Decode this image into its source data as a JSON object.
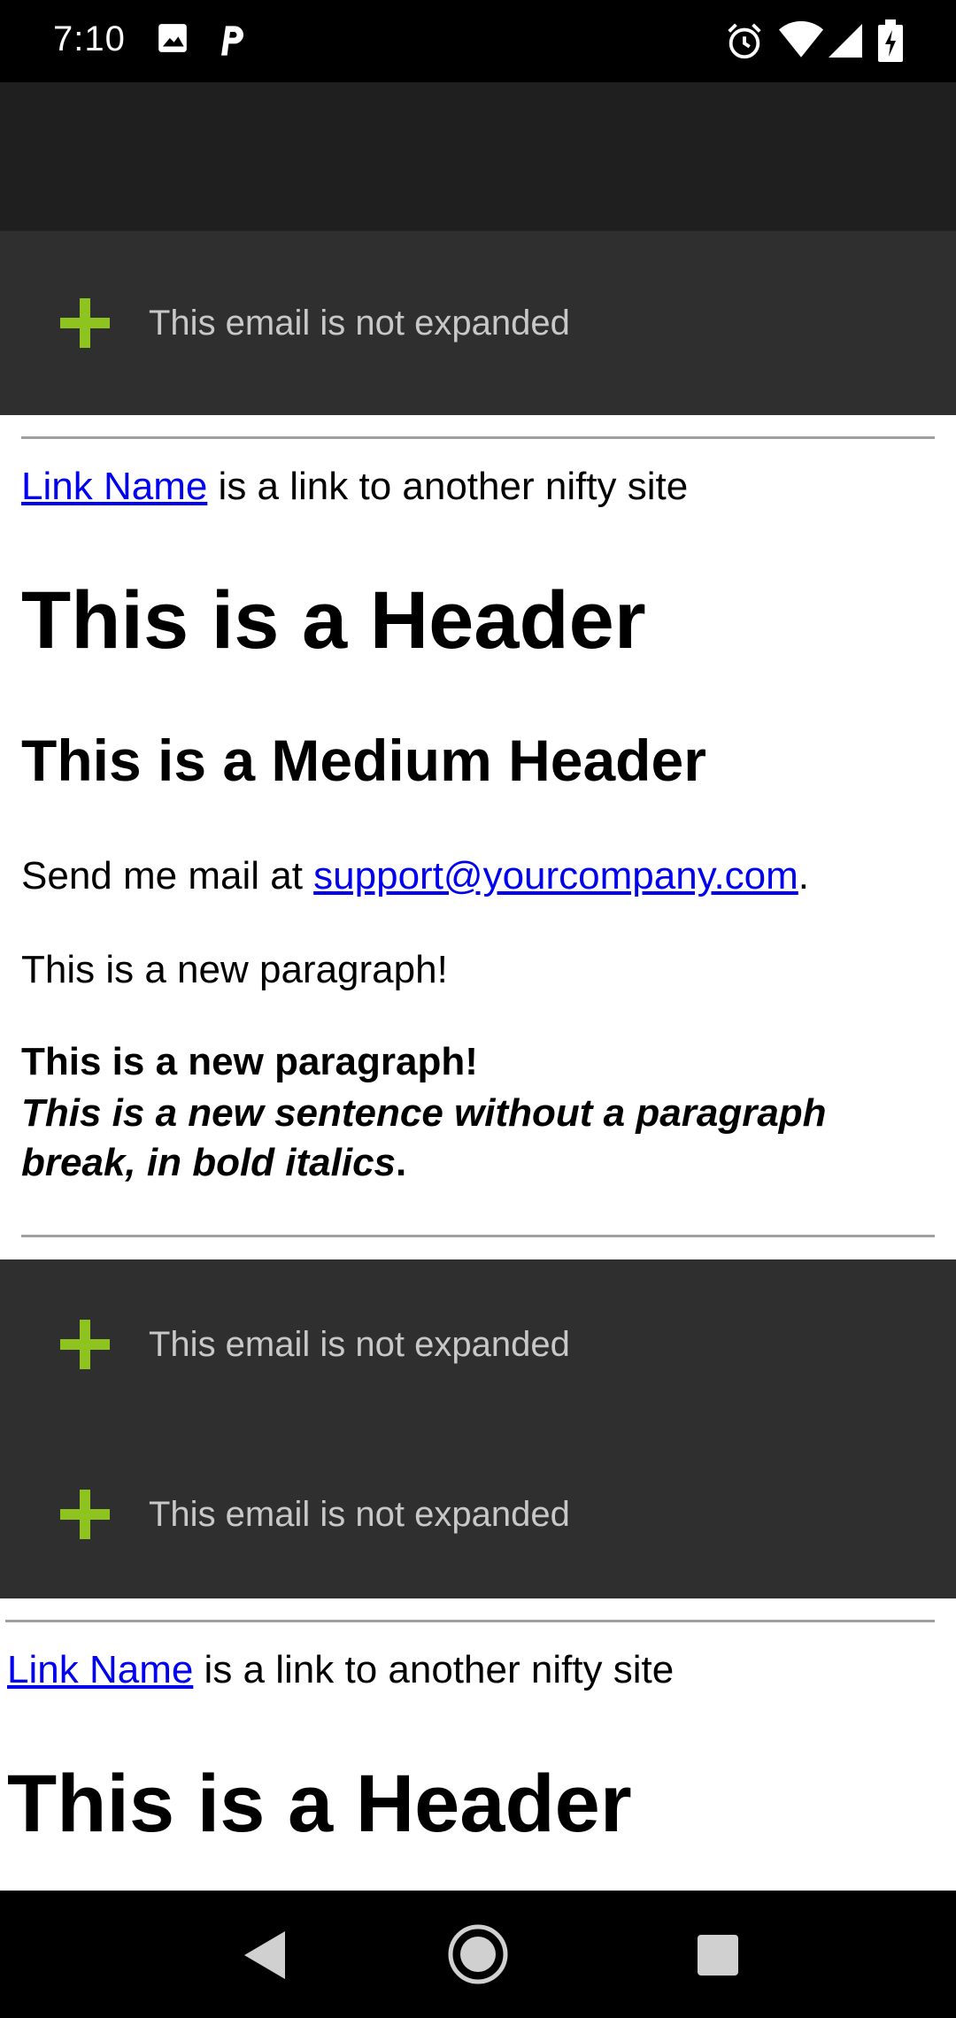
{
  "status_bar": {
    "time": "7:10",
    "icons": [
      "image-icon",
      "parking-p-icon",
      "alarm-icon",
      "wifi-icon",
      "signal-icon",
      "battery-charging-icon"
    ]
  },
  "collapsed_emails": {
    "top": {
      "label": "This email is not expanded"
    },
    "middle_1": {
      "label": "This email is not expanded"
    },
    "middle_2": {
      "label": "This email is not expanded"
    }
  },
  "section1": {
    "link_text": "Link Name",
    "link_suffix": " is a link to another nifty site",
    "header": "This is a Header",
    "medium_header": "This is a Medium Header",
    "mail_prefix": "Send me mail at ",
    "mail_link": "support@yourcompany.com",
    "mail_suffix": ".",
    "paragraph": "This is a new paragraph!",
    "bold_paragraph": "This is a new paragraph!",
    "bold_italic_line1": "This is a new sentence without a paragraph",
    "bold_italic_line2": "break, in bold italics",
    "bold_italic_end": "."
  },
  "section2": {
    "link_text": "Link Name",
    "link_suffix": " is a link to another nifty site",
    "header": "This is a Header"
  },
  "colors": {
    "accent_plus": "#8fc31f",
    "collapsed_bg": "#2f2f30",
    "toolbar_bg": "#1f1f1f",
    "link": "#0000ee"
  }
}
